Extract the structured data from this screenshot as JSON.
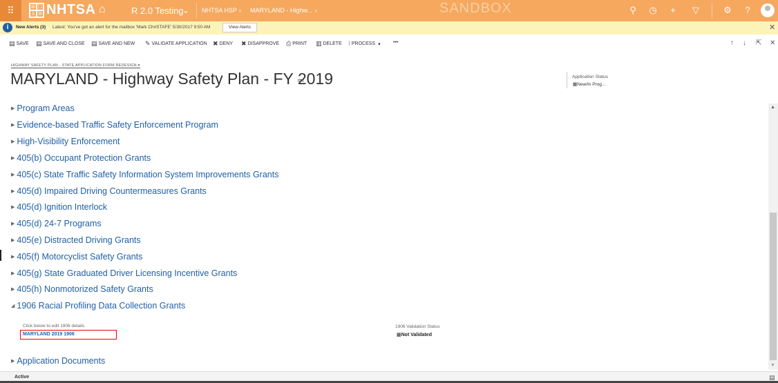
{
  "app": {
    "logo_cells": [
      "⊞",
      "☐",
      "♙",
      "⚙"
    ],
    "logo_text": "NHTSA",
    "environment": "R 2.0 Testing",
    "breadcrumb": [
      "NHTSA HSP",
      "MARYLAND - Highw..."
    ],
    "watermark": "SANDBOX",
    "accent_color": "#f5a85e",
    "icons": [
      "search-icon",
      "history-icon",
      "plus-icon",
      "filter-icon",
      "settings-icon",
      "help-icon",
      "user-avatar"
    ]
  },
  "alerts": {
    "title": "New Alerts (3)",
    "message": "Latest: You've got an alert for the mailbox 'Mark ChriSTAFE' 5/30/2017 9:50 AM",
    "button": "View Alerts"
  },
  "commands": {
    "save": "SAVE",
    "save_close": "SAVE AND CLOSE",
    "save_new": "SAVE AND NEW",
    "validate": "VALIDATE APPLICATION",
    "deny": "DENY",
    "disapprove": "DISAPPROVE",
    "print": "PRINT",
    "delete": "DELETE",
    "process": "PROCESS",
    "more": "•••"
  },
  "form": {
    "selector": "HIGHWAY SAFETY PLAN - STATE APPLICATION FORM REDESIGN ▾",
    "title": "MARYLAND - Highway Safety Plan - FY 2019",
    "status_label": "Application Status",
    "status_value": "New/In Prog..."
  },
  "sections": [
    "Program Areas",
    "Evidence-based Traffic Safety Enforcement Program",
    "High-Visibility Enforcement",
    "405(b) Occupant Protection Grants",
    "405(c) State Traffic Safety Information System Improvements Grants",
    "405(d) Impaired Driving Countermeasures Grants",
    "405(d) Ignition Interlock",
    "405(d) 24-7 Programs",
    "405(e) Distracted Driving Grants",
    "405(f) Motorcyclist Safety Grants",
    "405(g) State Graduated Driver Licensing Incentive Grants",
    "405(h) Nonmotorized Safety Grants",
    "1906 Racial Profiling Data Collection Grants",
    "Application Documents"
  ],
  "section_1906": {
    "edit_label": "Click below to edit 1906 details",
    "lookup_value": "MARYLAND 2019 1906",
    "validation_label": "1906 Validation Status",
    "validation_value": "Not Validated"
  },
  "footer": {
    "status": "Active"
  }
}
